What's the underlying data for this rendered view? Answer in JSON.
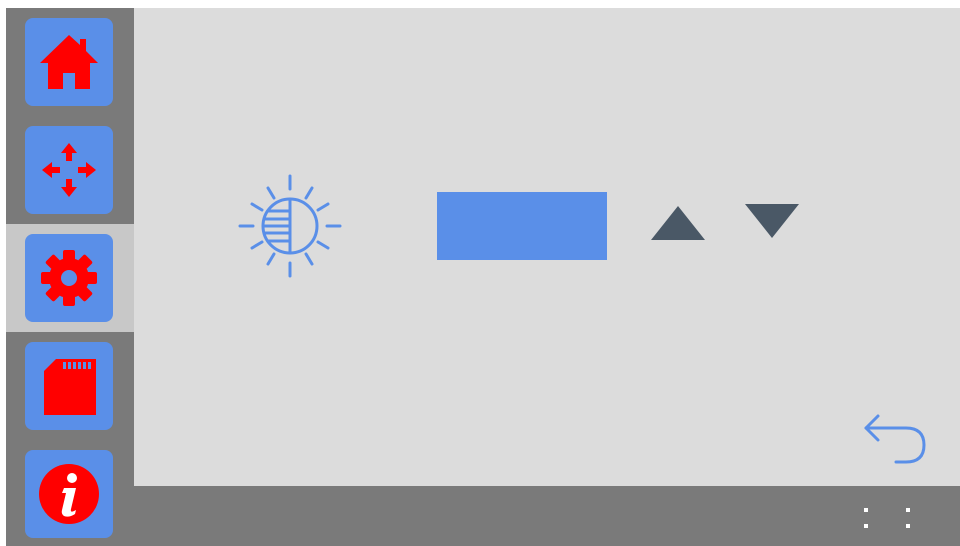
{
  "colors": {
    "frame": "#7a7a7a",
    "content_bg": "#dcdcdc",
    "active_slot": "#c8c8c8",
    "button_blue": "#5a8fe8",
    "icon_red": "#ff0000",
    "arrow_gray": "#4a5866",
    "dots_white": "#ffffff"
  },
  "sidebar": {
    "items": [
      {
        "id": "home",
        "icon": "home-icon",
        "active": false
      },
      {
        "id": "move",
        "icon": "move-arrows-icon",
        "active": false
      },
      {
        "id": "settings",
        "icon": "gear-icon",
        "active": true
      },
      {
        "id": "sd-card",
        "icon": "sd-card-icon",
        "active": false
      },
      {
        "id": "info",
        "icon": "info-icon",
        "active": false
      }
    ]
  },
  "main": {
    "setting_icon": "brightness-icon",
    "value_display": "",
    "increase_icon": "triangle-up-icon",
    "decrease_icon": "triangle-down-icon",
    "back_icon": "back-arrow-icon"
  },
  "bottom_bar": {
    "menu_icon": "menu-dots-icon"
  }
}
